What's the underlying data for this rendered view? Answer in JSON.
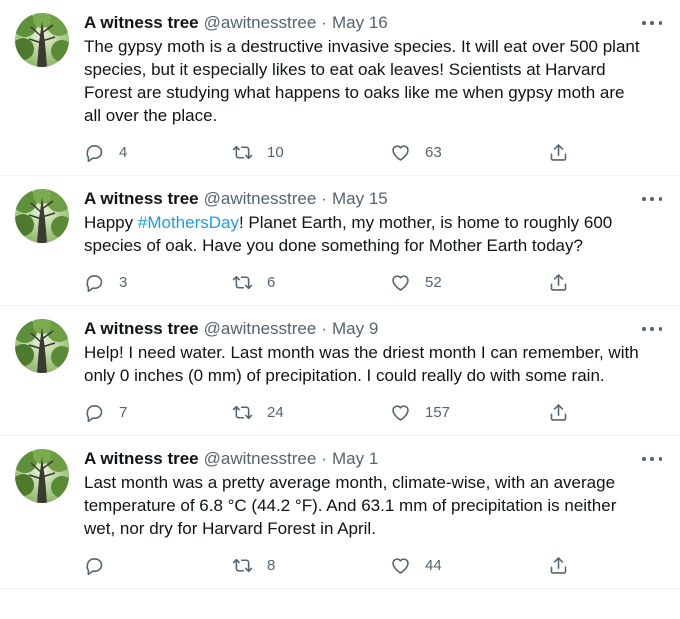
{
  "tweets": [
    {
      "name": "A witness tree",
      "handle": "@awitnesstree",
      "separator": "·",
      "date": "May 16",
      "text_parts": [
        "The gypsy moth is a destructive invasive species. It will eat over 500 plant species, but it especially likes to eat oak leaves! Scientists at Harvard Forest are studying what happens to oaks like me when gypsy moth are all over the place.",
        "",
        ""
      ],
      "replies": "4",
      "retweets": "10",
      "likes": "63"
    },
    {
      "name": "A witness tree",
      "handle": "@awitnesstree",
      "separator": "·",
      "date": "May 15",
      "text_parts": [
        "Happy ",
        "#MothersDay",
        "! Planet Earth, my mother, is home to roughly 600 species of oak. Have you done something for Mother Earth today?"
      ],
      "replies": "3",
      "retweets": "6",
      "likes": "52"
    },
    {
      "name": "A witness tree",
      "handle": "@awitnesstree",
      "separator": "·",
      "date": "May 9",
      "text_parts": [
        "Help! I need water. Last month was the driest month I can remember, with only 0 inches (0 mm) of precipitation. I could really do with some rain.",
        "",
        ""
      ],
      "replies": "7",
      "retweets": "24",
      "likes": "157"
    },
    {
      "name": "A witness tree",
      "handle": "@awitnesstree",
      "separator": "·",
      "date": "May 1",
      "text_parts": [
        "Last month was a pretty average month, climate-wise, with an average temperature of 6.8 °C (44.2 °F). And 63.1 mm of precipitation is neither wet, nor dry for Harvard Forest in April.",
        "",
        ""
      ],
      "replies": "",
      "retweets": "8",
      "likes": "44"
    }
  ],
  "icons": {
    "reply": "reply-icon",
    "retweet": "retweet-icon",
    "like": "heart-icon",
    "share": "share-icon",
    "more": "more-icon"
  },
  "colors": {
    "text": "#0f1419",
    "secondary": "#536471",
    "hashtag": "#1d9bf0",
    "divider": "#eff3f4"
  }
}
